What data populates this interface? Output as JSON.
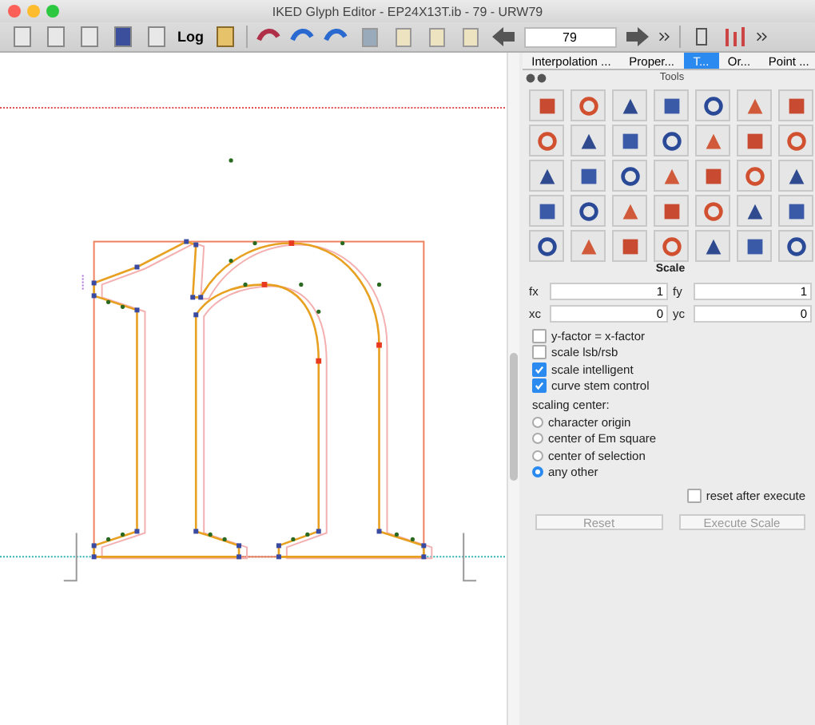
{
  "window": {
    "title": "IKED Glyph Editor - EP24X13T.ib - 79 - URW79"
  },
  "toolbar": {
    "log_label": "Log",
    "glyph_field": "79"
  },
  "tabs": [
    {
      "label": "Interpolation ...",
      "selected": false
    },
    {
      "label": "Proper...",
      "selected": false
    },
    {
      "label": "T...",
      "selected": true
    },
    {
      "label": "Or...",
      "selected": false
    },
    {
      "label": "Point ...",
      "selected": false
    }
  ],
  "tools_panel": {
    "title": "Tools",
    "section": "Scale",
    "fields": [
      {
        "label": "fx",
        "value": "1"
      },
      {
        "label": "fy",
        "value": "1"
      },
      {
        "label": "xc",
        "value": "0"
      },
      {
        "label": "yc",
        "value": "0"
      }
    ],
    "options": [
      {
        "label": "y-factor = x-factor",
        "checked": false
      },
      {
        "label": "scale lsb/rsb",
        "checked": false
      },
      {
        "label": "scale intelligent",
        "checked": true
      },
      {
        "label": "curve stem control",
        "checked": true
      }
    ],
    "center_label": "scaling center:",
    "centers": [
      {
        "label": "character origin",
        "selected": false
      },
      {
        "label": "center of Em square",
        "selected": false
      },
      {
        "label": "center of selection",
        "selected": false
      },
      {
        "label": "any other",
        "selected": true
      }
    ],
    "reset_after_execute": {
      "label": "reset after execute",
      "checked": false
    },
    "buttons": [
      {
        "label": "Reset",
        "disabled": true
      },
      {
        "label": "Execute Scale",
        "disabled": true
      }
    ]
  }
}
